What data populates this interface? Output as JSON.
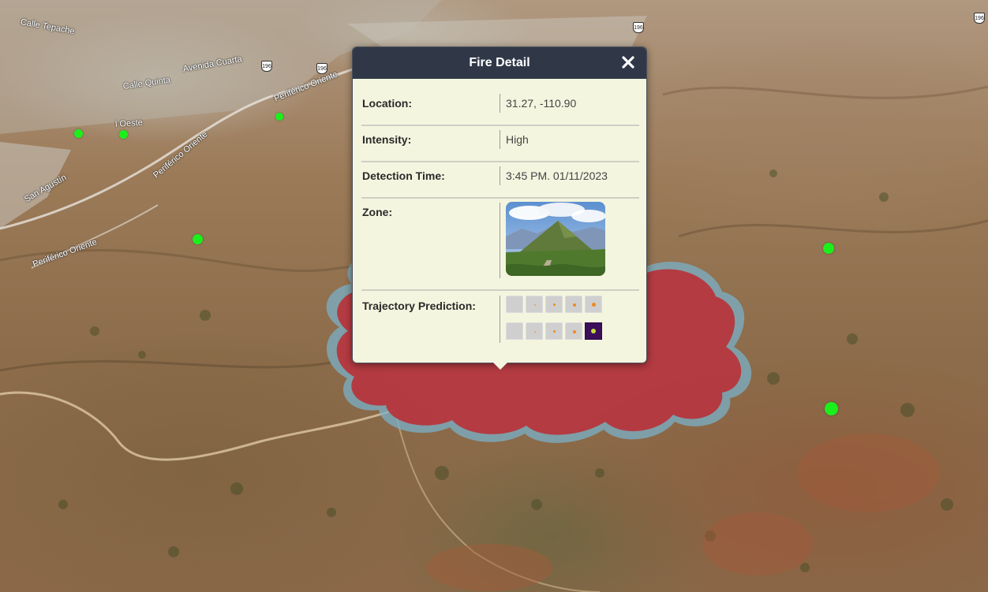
{
  "map": {
    "road_labels": [
      {
        "text": "Calle Tepache"
      },
      {
        "text": "Avenida Cuarta"
      },
      {
        "text": "Calle Quinta"
      },
      {
        "text": "Periférico Oriente"
      },
      {
        "text": "Periférico Oriente"
      },
      {
        "text": "Periférico Oriente"
      },
      {
        "text": "l Oeste"
      },
      {
        "text": "San Agustín"
      }
    ],
    "highway_shields": [
      "196",
      "196",
      "196",
      "196"
    ],
    "hotspot_color": "#1cf01c",
    "fire_zone_color": "#b8323a"
  },
  "popup": {
    "title": "Fire Detail",
    "close_icon": "close-icon",
    "header_color": "#303848",
    "background_color": "#f4f5df",
    "rows": {
      "location": {
        "label": "Location:",
        "value": "31.27, -110.90"
      },
      "intensity": {
        "label": "Intensity:",
        "value": "High"
      },
      "detection_time": {
        "label": "Detection Time:",
        "value": "3:45 PM. 01/11/2023"
      },
      "zone": {
        "label": "Zone:",
        "image": "mountain-landscape-thumbnail"
      },
      "trajectory": {
        "label": "Trajectory Prediction:",
        "image": "trajectory-prediction-grid"
      }
    }
  }
}
